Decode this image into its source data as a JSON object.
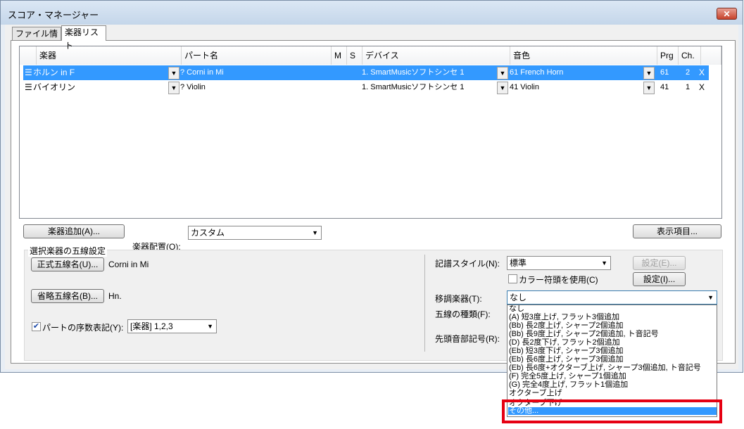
{
  "window": {
    "title": "スコア・マネージャー",
    "close_label": "✕"
  },
  "tabs": [
    {
      "label": "ファイル情報"
    },
    {
      "label": "楽器リスト"
    }
  ],
  "grid": {
    "headers": [
      "楽器",
      "パート名",
      "M",
      "S",
      "デバイス",
      "音色",
      "Prg",
      "Ch."
    ],
    "rows": [
      {
        "icon": "☰",
        "instrument": "ホルン in F",
        "part": "? Corni in Mi",
        "device": "1. SmartMusicソフトシンセ 1",
        "sound": "61 French Horn",
        "prg": "61",
        "ch": "2",
        "x": "X"
      },
      {
        "icon": "☰",
        "instrument": "バイオリン",
        "part": "? Violin",
        "device": "1. SmartMusicソフトシンセ 1",
        "sound": "41 Violin",
        "prg": "41",
        "ch": "1",
        "x": "X"
      }
    ]
  },
  "buttons": {
    "add_instrument": "楽器追加(A)...",
    "display_items": "表示項目...",
    "full_name": "正式五線名(U)...",
    "abbr_name": "省略五線名(B)...",
    "settings_e": "設定(E)...",
    "settings_i": "設定(I)..."
  },
  "layout_combo": {
    "value": "カスタム",
    "label": "楽器配置(O):"
  },
  "group": {
    "label": "選択楽器の五線設定",
    "full_name_value": "Corni in Mi",
    "abbr_name_value": "Hn.",
    "part_numbering_label": "パートの序数表記(Y):",
    "part_numbering_value": "[楽器] 1,2,3",
    "notation_style_label": "記譜スタイル(N):",
    "notation_style_value": "標準",
    "color_noteheads_label": "カラー符頭を使用(C)",
    "transposition_label": "移調楽器(T):",
    "transposition_value": "なし",
    "staff_type_label": "五線の種類(F):",
    "first_clef_label": "先頭音部記号(R):"
  },
  "dropdown_options": [
    "なし",
    "(A) 短3度上げ, フラット3個追加",
    "(Bb) 長2度上げ, シャープ2個追加",
    "(Bb) 長9度上げ, シャープ2個追加, ト音記号",
    "(D) 長2度下げ, フラット2個追加",
    "(Eb) 短3度下げ, シャープ3個追加",
    "(Eb) 長6度上げ, シャープ3個追加",
    "(Eb) 長6度+オクターブ上げ, シャープ3個追加, ト音記号",
    "(F) 完全5度上げ, シャープ1個追加",
    "(G) 完全4度上げ, フラット1個追加",
    "オクターブ上げ",
    "オクターブ下げ",
    "その他..."
  ],
  "colors": {
    "selection": "#3399ff",
    "highlight_box": "#e60012"
  }
}
